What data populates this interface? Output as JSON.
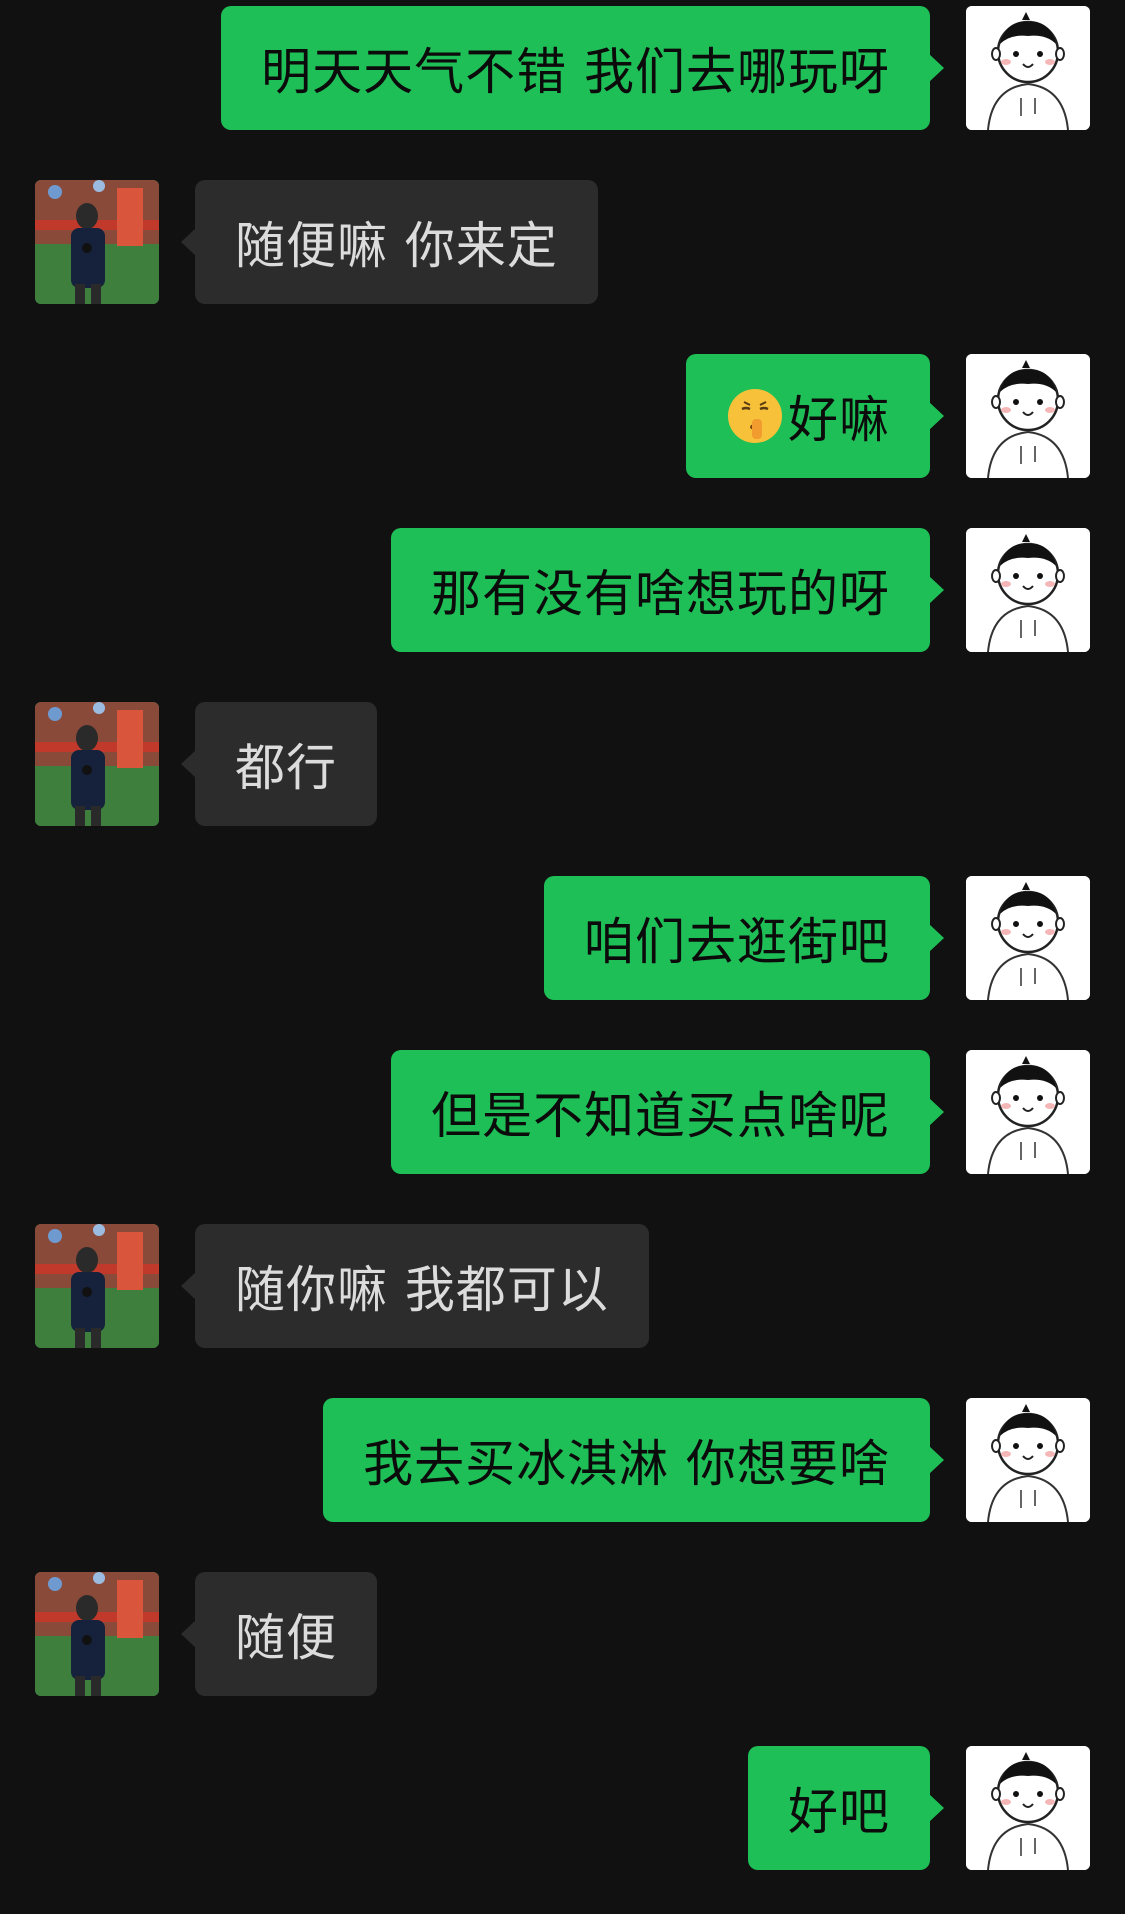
{
  "colors": {
    "background": "#111111",
    "sent_bubble": "#1fbf57",
    "received_bubble": "#2c2c2c",
    "received_text": "#dcdcdc"
  },
  "messages": [
    {
      "side": "sent",
      "text": "明天天气不错 我们去哪玩呀"
    },
    {
      "side": "received",
      "text": "随便嘛 你来定"
    },
    {
      "side": "sent",
      "text": "好嘛",
      "emoji": "shushing-face-icon"
    },
    {
      "side": "sent",
      "text": "那有没有啥想玩的呀"
    },
    {
      "side": "received",
      "text": "都行"
    },
    {
      "side": "sent",
      "text": "咱们去逛街吧"
    },
    {
      "side": "sent",
      "text": "但是不知道买点啥呢"
    },
    {
      "side": "received",
      "text": "随你嘛 我都可以"
    },
    {
      "side": "sent",
      "text": "我去买冰淇淋 你想要啥"
    },
    {
      "side": "received",
      "text": "随便"
    },
    {
      "side": "sent",
      "text": "好吧"
    }
  ]
}
